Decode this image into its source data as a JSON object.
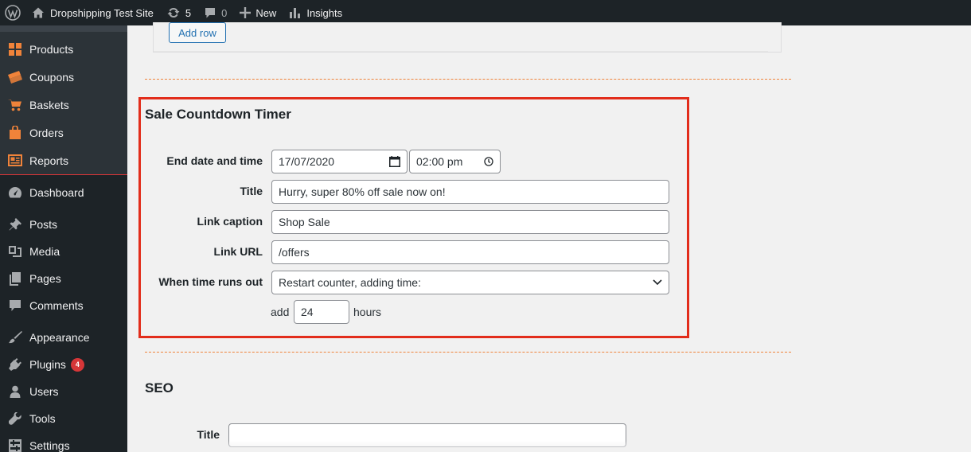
{
  "adminbar": {
    "site_name": "Dropshipping Test Site",
    "updates_count": "5",
    "comments_count": "0",
    "new_label": "New",
    "insights_label": "Insights"
  },
  "sidebar": {
    "woocommerce_items": [
      {
        "label": "Products",
        "icon": "products-grid-icon"
      },
      {
        "label": "Coupons",
        "icon": "coupons-icon"
      },
      {
        "label": "Baskets",
        "icon": "basket-icon"
      },
      {
        "label": "Orders",
        "icon": "orders-bag-icon"
      },
      {
        "label": "Reports",
        "icon": "reports-icon"
      }
    ],
    "main_items": [
      {
        "label": "Dashboard",
        "icon": "dashboard-icon"
      },
      {
        "label": "Posts",
        "icon": "pushpin-icon"
      },
      {
        "label": "Media",
        "icon": "media-icon"
      },
      {
        "label": "Pages",
        "icon": "pages-icon"
      },
      {
        "label": "Comments",
        "icon": "comment-icon"
      },
      {
        "label": "Appearance",
        "icon": "paintbrush-icon"
      },
      {
        "label": "Plugins",
        "icon": "plugin-icon",
        "badge": "4"
      },
      {
        "label": "Users",
        "icon": "user-icon"
      },
      {
        "label": "Tools",
        "icon": "wrench-icon"
      },
      {
        "label": "Settings",
        "icon": "settings-icon"
      }
    ]
  },
  "table": {
    "add_row_label": "Add row"
  },
  "countdown": {
    "section_title": "Sale Countdown Timer",
    "end_date_label": "End date and time",
    "end_date_value": "17/07/2020",
    "end_time_value": "02:00 pm",
    "title_label": "Title",
    "title_value": "Hurry, super 80% off sale now on!",
    "link_caption_label": "Link caption",
    "link_caption_value": "Shop Sale",
    "link_url_label": "Link URL",
    "link_url_value": "/offers",
    "when_runs_out_label": "When time runs out",
    "when_runs_out_value": "Restart counter, adding time:",
    "add_label": "add",
    "add_hours_value": "24",
    "hours_label": "hours"
  },
  "seo": {
    "section_title": "SEO",
    "title_label": "Title",
    "title_value": ""
  },
  "colors": {
    "adminbar_bg": "#1d2327",
    "woocommerce_accent": "#f0833a",
    "highlight_border": "#e22d1b",
    "link_blue": "#2271b1",
    "badge_red": "#d63638"
  }
}
